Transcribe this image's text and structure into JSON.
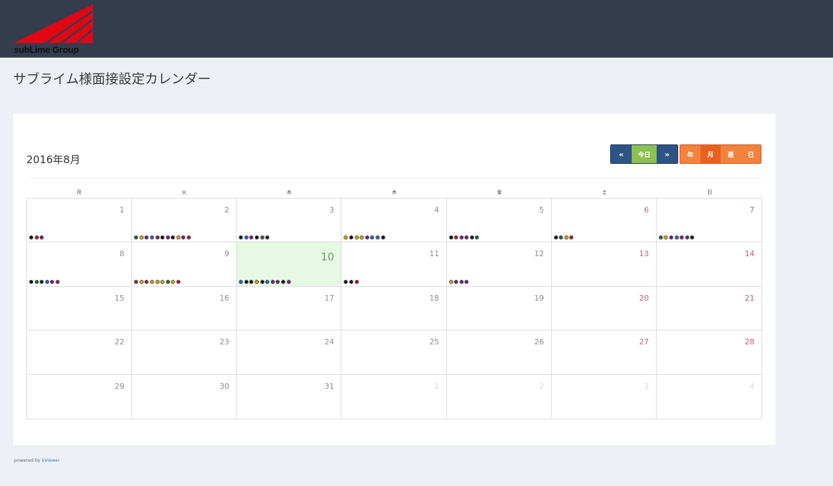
{
  "header": {
    "logo_text": "subLime Group",
    "logo_color": "#e30613"
  },
  "page": {
    "title": "サブライム様面接設定カレンダー"
  },
  "calendar": {
    "month_title": "2016年8月",
    "nav": {
      "prev": "«",
      "today": "今日",
      "next": "»"
    },
    "views": {
      "year": "年",
      "month": "月",
      "week": "週",
      "day": "日"
    },
    "active_view": "month",
    "days_of_week": [
      "月",
      "火",
      "水",
      "木",
      "金",
      "土",
      "日"
    ],
    "weeks": [
      [
        {
          "day": "1",
          "weekend": false,
          "other": false,
          "today": false,
          "dots": [
            "#111111",
            "#b0182d",
            "#7a1a7a"
          ]
        },
        {
          "day": "2",
          "weekend": false,
          "other": false,
          "today": false,
          "dots": [
            "#1c6b2a",
            "#d8a500",
            "#7a1a7a",
            "#1f63c7",
            "#7a1a7a",
            "#111111",
            "#7a1a7a",
            "#111111",
            "#d8a500",
            "#7a1a7a",
            "#b0182d"
          ]
        },
        {
          "day": "3",
          "weekend": false,
          "other": false,
          "today": false,
          "dots": [
            "#111111",
            "#1f63c7",
            "#7a1a7a",
            "#111111",
            "#1c6b2a",
            "#111111"
          ]
        },
        {
          "day": "4",
          "weekend": false,
          "other": false,
          "today": false,
          "dots": [
            "#d8a500",
            "#111111",
            "#d8a500",
            "#d8a500",
            "#7a1a7a",
            "#1f63c7",
            "#1f63c7",
            "#111111"
          ]
        },
        {
          "day": "5",
          "weekend": false,
          "other": false,
          "today": false,
          "dots": [
            "#111111",
            "#b0182d",
            "#7a1a7a",
            "#7a1a7a",
            "#111111",
            "#1c6b2a"
          ]
        },
        {
          "day": "6",
          "weekend": true,
          "other": false,
          "today": false,
          "dots": [
            "#111111",
            "#1c6b2a",
            "#d8a500",
            "#b0182d"
          ]
        },
        {
          "day": "7",
          "weekend": true,
          "other": false,
          "today": false,
          "dots": [
            "#1c6b2a",
            "#d8a500",
            "#7a1a7a",
            "#1f63c7",
            "#7a1a7a",
            "#7a1a7a",
            "#111111"
          ]
        }
      ],
      [
        {
          "day": "8",
          "weekend": false,
          "other": false,
          "today": false,
          "dots": [
            "#111111",
            "#1c6b2a",
            "#111111",
            "#1f63c7",
            "#7a1a7a",
            "#b0182d"
          ]
        },
        {
          "day": "9",
          "weekend": false,
          "other": false,
          "today": false,
          "dots": [
            "#b0182d",
            "#d8a500",
            "#b0182d",
            "#d8a500",
            "#d8a500",
            "#d8a500",
            "#1c6b2a",
            "#d8a500",
            "#b0182d"
          ]
        },
        {
          "day": "10",
          "weekend": false,
          "other": false,
          "today": true,
          "dots": [
            "#1f63c7",
            "#111111",
            "#111111",
            "#d8a500",
            "#111111",
            "#1f63c7",
            "#7a1a7a",
            "#7a1a7a",
            "#111111",
            "#7a1a7a"
          ]
        },
        {
          "day": "11",
          "weekend": false,
          "other": false,
          "today": false,
          "dots": [
            "#111111",
            "#111111",
            "#b0182d"
          ]
        },
        {
          "day": "12",
          "weekend": false,
          "other": false,
          "today": false,
          "dots": [
            "#d8a500",
            "#7a1a7a",
            "#7a1a7a",
            "#7a1a7a"
          ]
        },
        {
          "day": "13",
          "weekend": true,
          "other": false,
          "today": false,
          "dots": []
        },
        {
          "day": "14",
          "weekend": true,
          "other": false,
          "today": false,
          "dots": []
        }
      ],
      [
        {
          "day": "15",
          "weekend": false,
          "other": false,
          "today": false,
          "dots": []
        },
        {
          "day": "16",
          "weekend": false,
          "other": false,
          "today": false,
          "dots": []
        },
        {
          "day": "17",
          "weekend": false,
          "other": false,
          "today": false,
          "dots": []
        },
        {
          "day": "18",
          "weekend": false,
          "other": false,
          "today": false,
          "dots": []
        },
        {
          "day": "19",
          "weekend": false,
          "other": false,
          "today": false,
          "dots": []
        },
        {
          "day": "20",
          "weekend": true,
          "other": false,
          "today": false,
          "dots": []
        },
        {
          "day": "21",
          "weekend": true,
          "other": false,
          "today": false,
          "dots": []
        }
      ],
      [
        {
          "day": "22",
          "weekend": false,
          "other": false,
          "today": false,
          "dots": []
        },
        {
          "day": "23",
          "weekend": false,
          "other": false,
          "today": false,
          "dots": []
        },
        {
          "day": "24",
          "weekend": false,
          "other": false,
          "today": false,
          "dots": []
        },
        {
          "day": "25",
          "weekend": false,
          "other": false,
          "today": false,
          "dots": []
        },
        {
          "day": "26",
          "weekend": false,
          "other": false,
          "today": false,
          "dots": []
        },
        {
          "day": "27",
          "weekend": true,
          "other": false,
          "today": false,
          "dots": []
        },
        {
          "day": "28",
          "weekend": true,
          "other": false,
          "today": false,
          "dots": []
        }
      ],
      [
        {
          "day": "29",
          "weekend": false,
          "other": false,
          "today": false,
          "dots": []
        },
        {
          "day": "30",
          "weekend": false,
          "other": false,
          "today": false,
          "dots": []
        },
        {
          "day": "31",
          "weekend": false,
          "other": false,
          "today": false,
          "dots": []
        },
        {
          "day": "1",
          "weekend": false,
          "other": true,
          "today": false,
          "dots": []
        },
        {
          "day": "2",
          "weekend": false,
          "other": true,
          "today": false,
          "dots": []
        },
        {
          "day": "3",
          "weekend": true,
          "other": true,
          "today": false,
          "dots": []
        },
        {
          "day": "4",
          "weekend": true,
          "other": true,
          "today": false,
          "dots": []
        }
      ]
    ]
  },
  "footer": {
    "prefix": "powered by",
    "link": "kViewer"
  }
}
